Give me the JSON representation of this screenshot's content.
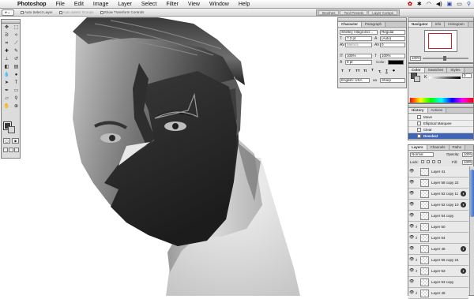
{
  "menubar": {
    "app": "Photoshop",
    "items": [
      "File",
      "Edit",
      "Image",
      "Layer",
      "Select",
      "Filter",
      "View",
      "Window",
      "Help"
    ]
  },
  "options": {
    "auto_select_layer": "Auto Select Layer",
    "auto_select_groups": "Auto Select Groups",
    "show_transform": "Show Transform Controls",
    "well_tabs": [
      "Brushes",
      "Tool Presets",
      "Layer Comps"
    ]
  },
  "character": {
    "tabs": [
      "Character",
      "Paragraph"
    ],
    "font_family": "Shelley AllegroScr...",
    "font_style": "Regular",
    "size": "7.2 pt",
    "leading": "(Auto)",
    "kerning": "Metrics",
    "tracking": "0",
    "vscale": "100%",
    "hscale": "100%",
    "baseline": "0 pt",
    "color_label": "Color:",
    "style_buttons": [
      "T",
      "T",
      "TT",
      "Tt",
      "T",
      "T,",
      "T",
      "T"
    ],
    "language": "English: USA",
    "antialias": "Sharp"
  },
  "navigator": {
    "tabs": [
      "Navigator",
      "Info",
      "Histogram"
    ],
    "zoom": "100%"
  },
  "color": {
    "tabs": [
      "Color",
      "Swatches",
      "Styles"
    ],
    "channel": "K",
    "value": "0"
  },
  "history": {
    "tabs": [
      "History",
      "Actions"
    ],
    "items": [
      {
        "label": "Move",
        "selected": false
      },
      {
        "label": "Elliptical Marquee",
        "selected": false
      },
      {
        "label": "Clear",
        "selected": false
      },
      {
        "label": "Deselect",
        "selected": true
      }
    ]
  },
  "layers": {
    "tabs": [
      "Layers",
      "Channels",
      "Paths"
    ],
    "blend_mode": "Normal",
    "opacity_label": "Opacity:",
    "opacity": "100%",
    "lock_label": "Lock:",
    "fill_label": "Fill:",
    "fill": "100%",
    "rows": [
      {
        "name": "Layer 41",
        "linked": false,
        "fx": false
      },
      {
        "name": "Layer 58 copy 22",
        "linked": false,
        "fx": false
      },
      {
        "name": "Layer 52 copy 11",
        "linked": false,
        "fx": true
      },
      {
        "name": "Layer 52 copy 10",
        "linked": false,
        "fx": true
      },
      {
        "name": "Layer 54 copy",
        "linked": false,
        "fx": false
      },
      {
        "name": "Layer 50",
        "linked": true,
        "fx": false
      },
      {
        "name": "Layer 54",
        "linked": true,
        "fx": false
      },
      {
        "name": "Layer 48",
        "linked": false,
        "fx": true
      },
      {
        "name": "Layer 56 copy 24",
        "linked": true,
        "fx": false
      },
      {
        "name": "Layer 53",
        "linked": true,
        "fx": true
      },
      {
        "name": "Layer 53 copy",
        "linked": false,
        "fx": false
      },
      {
        "name": "Layer 49",
        "linked": true,
        "fx": false
      }
    ]
  },
  "tool_icons": [
    "move-icon",
    "marquee-icon",
    "lasso-icon",
    "magic-wand-icon",
    "crop-icon",
    "slice-icon",
    "healing-icon",
    "brush-icon",
    "stamp-icon",
    "history-brush-icon",
    "eraser-icon",
    "gradient-icon",
    "blur-icon",
    "dodge-icon",
    "path-select-icon",
    "type-icon",
    "pen-icon",
    "shape-icon",
    "notes-icon",
    "eyedropper-icon",
    "hand-icon",
    "zoom-icon"
  ]
}
